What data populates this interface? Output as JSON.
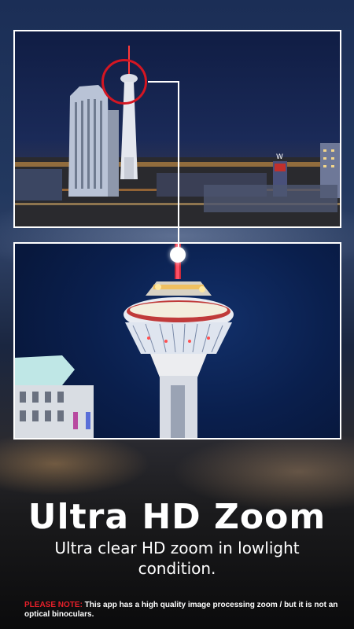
{
  "promo": {
    "headline": "Ultra HD Zoom",
    "subheadline": "Ultra clear HD zoom in lowlight condition.",
    "note_label": "PLEASE NOTE:",
    "note_text": " This app has a high quality image processing zoom / but it is not an optical binoculars."
  },
  "colors": {
    "accent_red": "#d41622",
    "note_label_red": "#e8202a",
    "text": "#ffffff",
    "sky": "#0a1f4d"
  },
  "preview": {
    "top_image": "city-skyline-night-photo",
    "bottom_image": "zoomed-tower-night-photo",
    "sign_text": "W"
  }
}
